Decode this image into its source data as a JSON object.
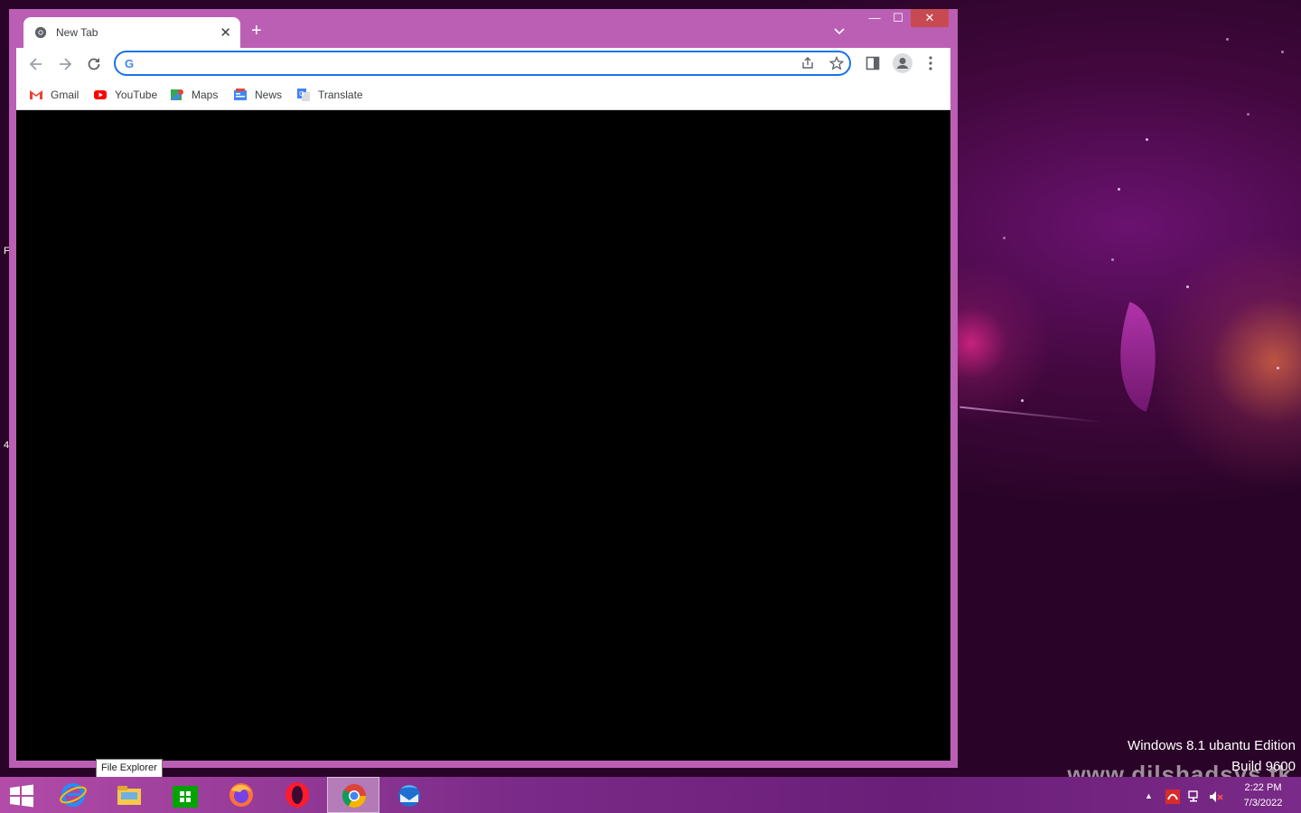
{
  "browser": {
    "tab": {
      "title": "New Tab",
      "close_glyph": "✕"
    },
    "new_tab_glyph": "+",
    "window_controls": {
      "minimize": "—",
      "maximize": "☐",
      "close": "✕"
    },
    "omnibox": {
      "value": "",
      "g_letter": "G"
    },
    "bookmarks": [
      {
        "label": "Gmail",
        "icon": "gmail-icon"
      },
      {
        "label": "YouTube",
        "icon": "youtube-icon"
      },
      {
        "label": "Maps",
        "icon": "maps-icon"
      },
      {
        "label": "News",
        "icon": "news-icon"
      },
      {
        "label": "Translate",
        "icon": "translate-icon"
      }
    ]
  },
  "desktop": {
    "edge_chars": [
      "F",
      "4"
    ],
    "edition_text": "Windows 8.1 ubantu Edition",
    "build_text": "Build 9600",
    "site_watermark": "www.dilshadsys.tk"
  },
  "tooltip": {
    "text": "File Explorer"
  },
  "taskbar": {
    "apps": [
      "internet-explorer-icon",
      "file-explorer-icon",
      "store-icon",
      "firefox-icon",
      "opera-icon",
      "chrome-icon",
      "thunderbird-icon"
    ],
    "active_app": "chrome-icon",
    "clock": {
      "time": "2:22 PM",
      "date": "7/3/2022"
    },
    "tray_up_glyph": "▲"
  }
}
